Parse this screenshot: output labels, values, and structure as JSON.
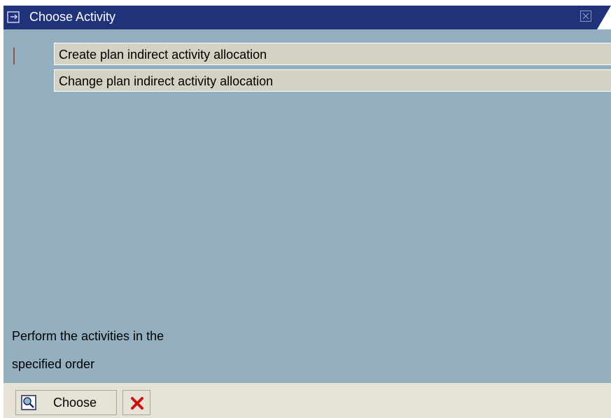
{
  "window": {
    "title": "Choose Activity"
  },
  "activities": [
    {
      "label": "Create plan indirect activity allocation"
    },
    {
      "label": "Change plan indirect activity allocation"
    }
  ],
  "hint": {
    "line1": "Perform the activities in the",
    "line2": "specified order"
  },
  "toolbar": {
    "choose_label": "Choose",
    "choose_icon": "choose-magnifier-icon",
    "cancel_icon": "cancel-x-icon"
  },
  "colors": {
    "title_bar": "#1f327a",
    "window_bg": "#94b0c0",
    "item_bg": "#d5d1c3",
    "toolbar_bg": "#e6e2d6",
    "cancel_red": "#cc1111"
  }
}
